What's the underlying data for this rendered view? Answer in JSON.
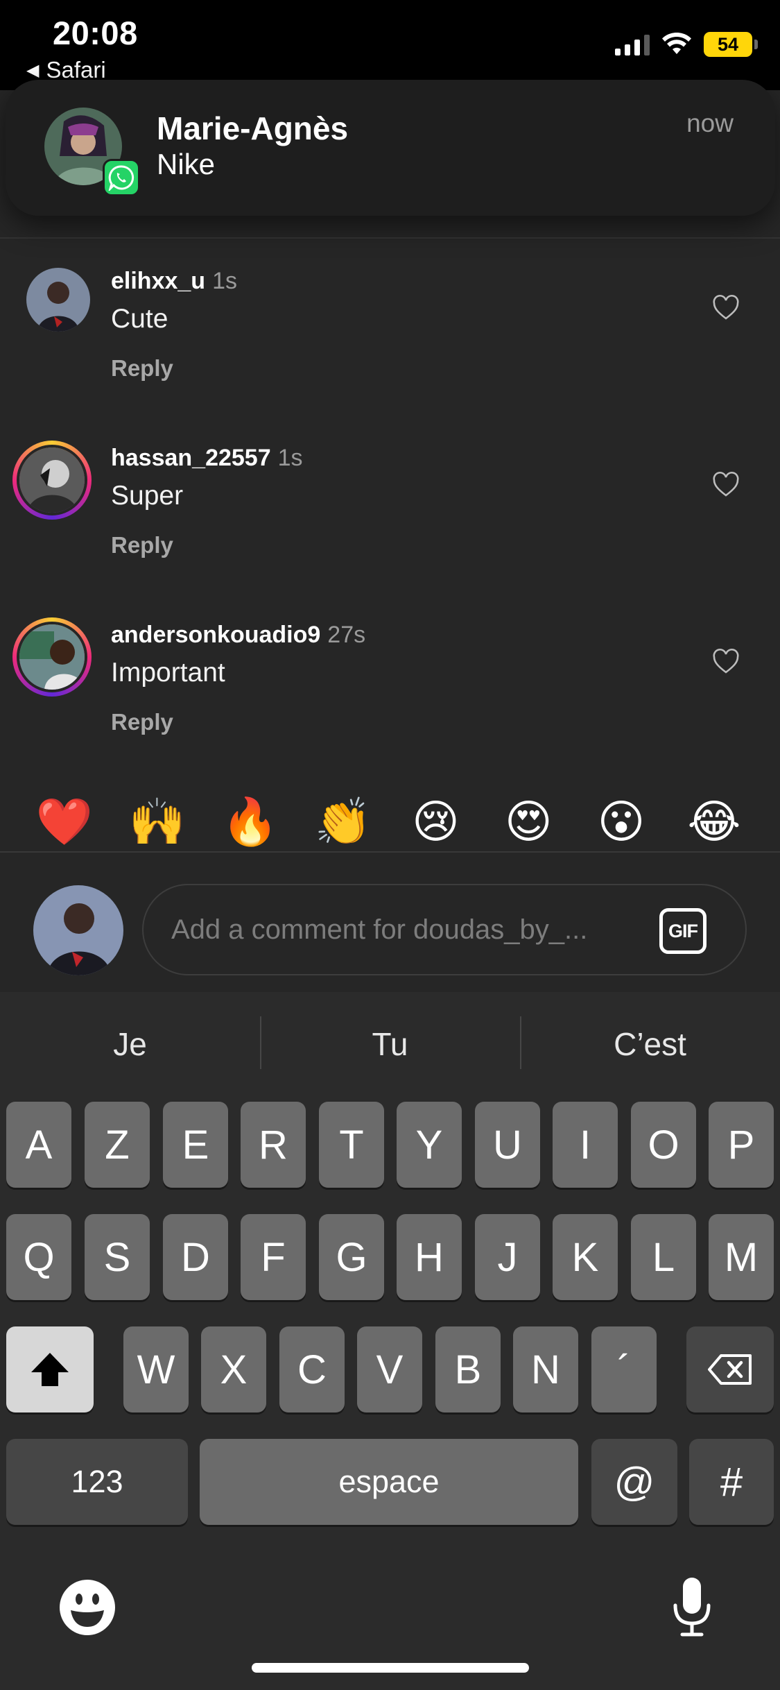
{
  "status_bar": {
    "time": "20:08",
    "back_label": "Safari",
    "battery": "54",
    "battery_color": "#ffd60a"
  },
  "notification": {
    "sender": "Marie-Agnès",
    "message": "Nike",
    "time": "now",
    "app_icon": "whatsapp-icon"
  },
  "comments": [
    {
      "user": "elihxx_u",
      "time": "1s",
      "text": "Cute",
      "reply": "Reply"
    },
    {
      "user": "hassan_22557",
      "time": "1s",
      "text": "Super",
      "reply": "Reply"
    },
    {
      "user": "andersonkouadio9",
      "time": "27s",
      "text": "Important",
      "reply": "Reply"
    }
  ],
  "emoji_bar": [
    "❤️",
    "🙌",
    "🔥",
    "👏",
    "😢",
    "😍",
    "😮",
    "😂"
  ],
  "composer": {
    "placeholder": "Add a comment for doudas_by_...",
    "gif_label": "GIF"
  },
  "keyboard": {
    "suggestions": [
      "Je",
      "Tu",
      "C’est"
    ],
    "row1": [
      "A",
      "Z",
      "E",
      "R",
      "T",
      "Y",
      "U",
      "I",
      "O",
      "P"
    ],
    "row2": [
      "Q",
      "S",
      "D",
      "F",
      "G",
      "H",
      "J",
      "K",
      "L",
      "M"
    ],
    "row3": [
      "W",
      "X",
      "C",
      "V",
      "B",
      "N",
      "´"
    ],
    "numbers_key": "123",
    "space_key": "espace",
    "at_key": "@",
    "hash_key": "#"
  }
}
